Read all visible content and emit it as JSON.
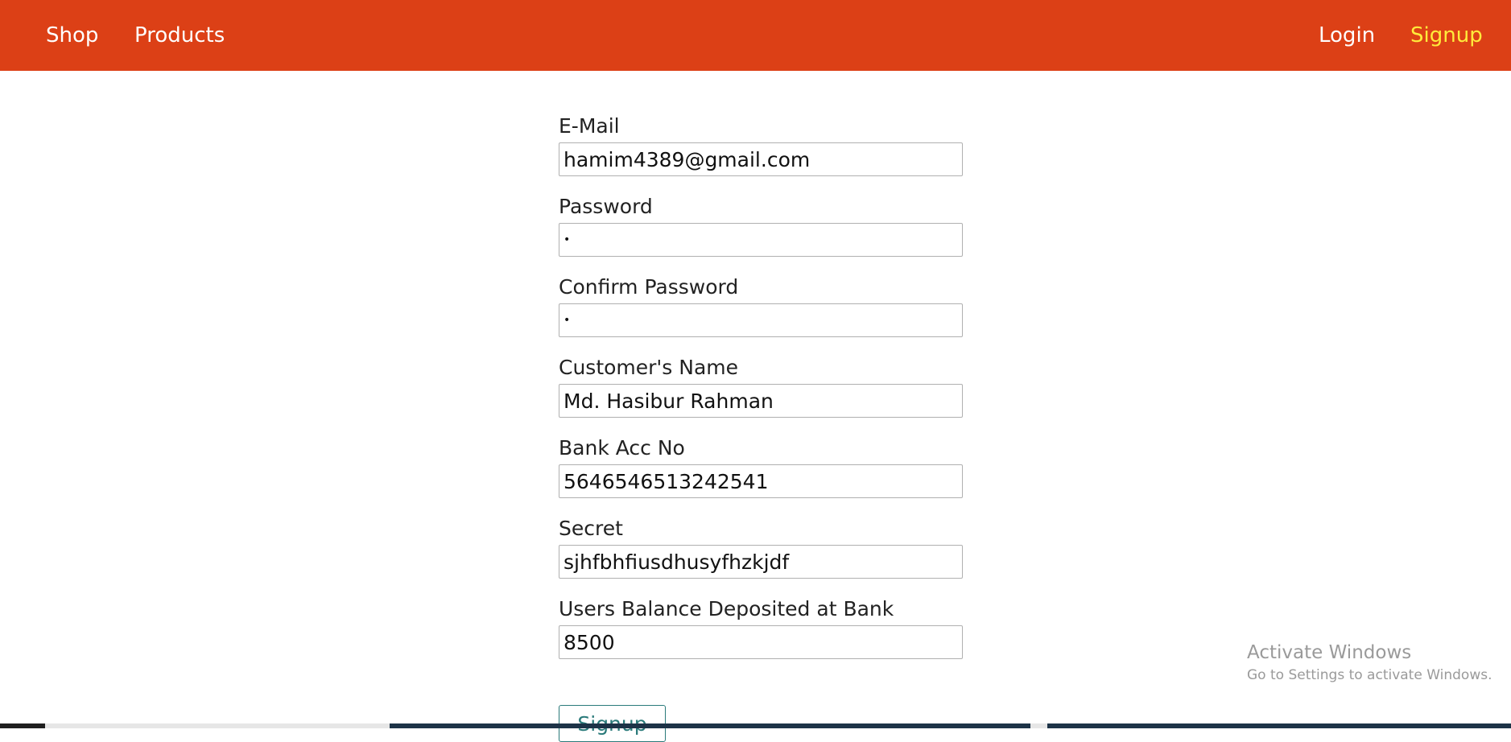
{
  "nav": {
    "shop": "Shop",
    "products": "Products",
    "login": "Login",
    "signup": "Signup",
    "background_color": "#dc4016",
    "active_color": "#ffeb3b"
  },
  "form": {
    "email_label": "E-Mail",
    "email_value": "hamim4389@gmail.com",
    "password_label": "Password",
    "password_value": "a",
    "confirm_password_label": "Confirm Password",
    "confirm_password_value": "a",
    "name_label": "Customer's Name",
    "name_value": "Md. Hasibur Rahman",
    "bank_acc_label": "Bank Acc No",
    "bank_acc_value": "5646546513242541",
    "secret_label": "Secret",
    "secret_value": "sjhfbhfiusdhusyfhzkjdf",
    "balance_label": "Users Balance Deposited at Bank",
    "balance_value": "8500",
    "submit_label": "Signup"
  },
  "watermark": {
    "title": "Activate Windows",
    "subtitle": "Go to Settings to activate Windows."
  }
}
